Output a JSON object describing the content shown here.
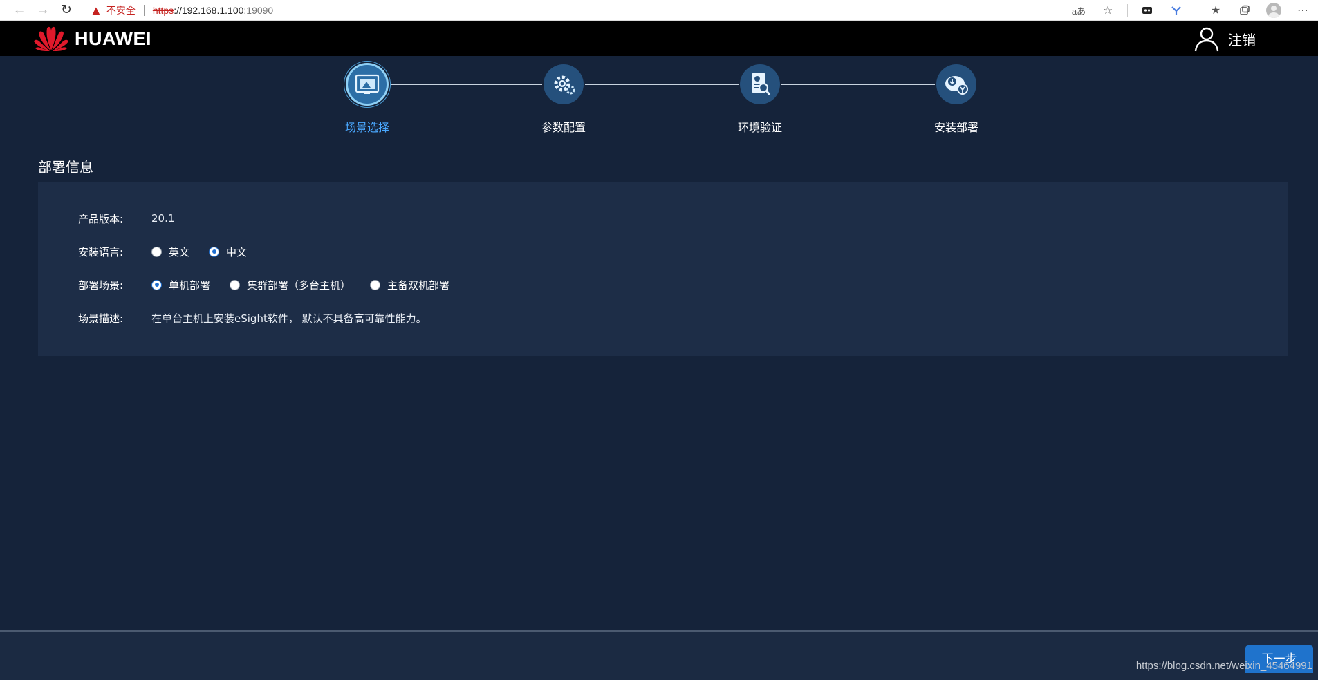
{
  "browser": {
    "back_icon": "arrow-left-icon",
    "forward_icon": "arrow-right-icon",
    "reload_icon": "reload-icon",
    "security_warning": "不安全",
    "url_protocol": "https",
    "url_separator": "://",
    "url_host": "192.168.1.100",
    "url_port": ":19090",
    "read_aloud_label": "aあ"
  },
  "header": {
    "brand": "HUAWEI",
    "logout_label": "注销"
  },
  "steps": [
    {
      "label": "场景选择",
      "active": true,
      "icon": "scene-select-icon"
    },
    {
      "label": "参数配置",
      "active": false,
      "icon": "gear-config-icon"
    },
    {
      "label": "环境验证",
      "active": false,
      "icon": "env-verify-icon"
    },
    {
      "label": "安装部署",
      "active": false,
      "icon": "install-deploy-icon"
    }
  ],
  "section": {
    "title": "部署信息",
    "product_version_label": "产品版本:",
    "product_version": "20.1",
    "language_label": "安装语言:",
    "language_options": [
      {
        "label": "英文",
        "checked": false
      },
      {
        "label": "中文",
        "checked": true
      }
    ],
    "scenario_label": "部署场景:",
    "scenario_options": [
      {
        "label": "单机部署",
        "checked": true
      },
      {
        "label": "集群部署（多台主机）",
        "checked": false
      },
      {
        "label": "主备双机部署",
        "checked": false
      }
    ],
    "description_label": "场景描述:",
    "description": "在单台主机上安装eSight软件， 默认不具备高可靠性能力。"
  },
  "footer": {
    "next_label": "下一步",
    "watermark": "https://blog.csdn.net/weixin_45464991"
  },
  "colors": {
    "background": "#15233a",
    "panel": "#1d2d47",
    "accent": "#1f73cc",
    "active_step_text": "#4aa8ff"
  }
}
